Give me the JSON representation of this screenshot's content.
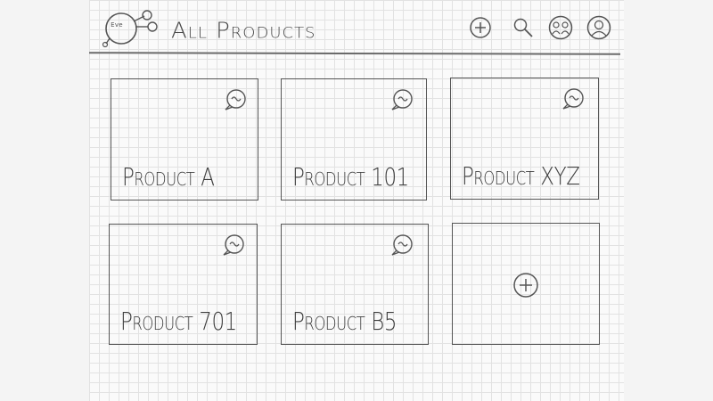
{
  "header": {
    "logo_text": "Eve",
    "title": "All Products",
    "icons": [
      "plus-circle-icon",
      "search-icon",
      "messages-icon",
      "user-profile-icon"
    ]
  },
  "products": [
    {
      "label": "Product A",
      "icon": "chat-bubble-icon"
    },
    {
      "label": "Product 101",
      "icon": "chat-bubble-icon"
    },
    {
      "label": "Product XYZ",
      "icon": "chat-bubble-icon"
    },
    {
      "label": "Product 701",
      "icon": "chat-bubble-icon"
    },
    {
      "label": "Product B5",
      "icon": "chat-bubble-icon"
    }
  ],
  "add_card": {
    "icon": "plus-circle-icon"
  },
  "style": {
    "ink": "#555555",
    "paper": "#fafafa",
    "grid": "#e2e2e2"
  }
}
